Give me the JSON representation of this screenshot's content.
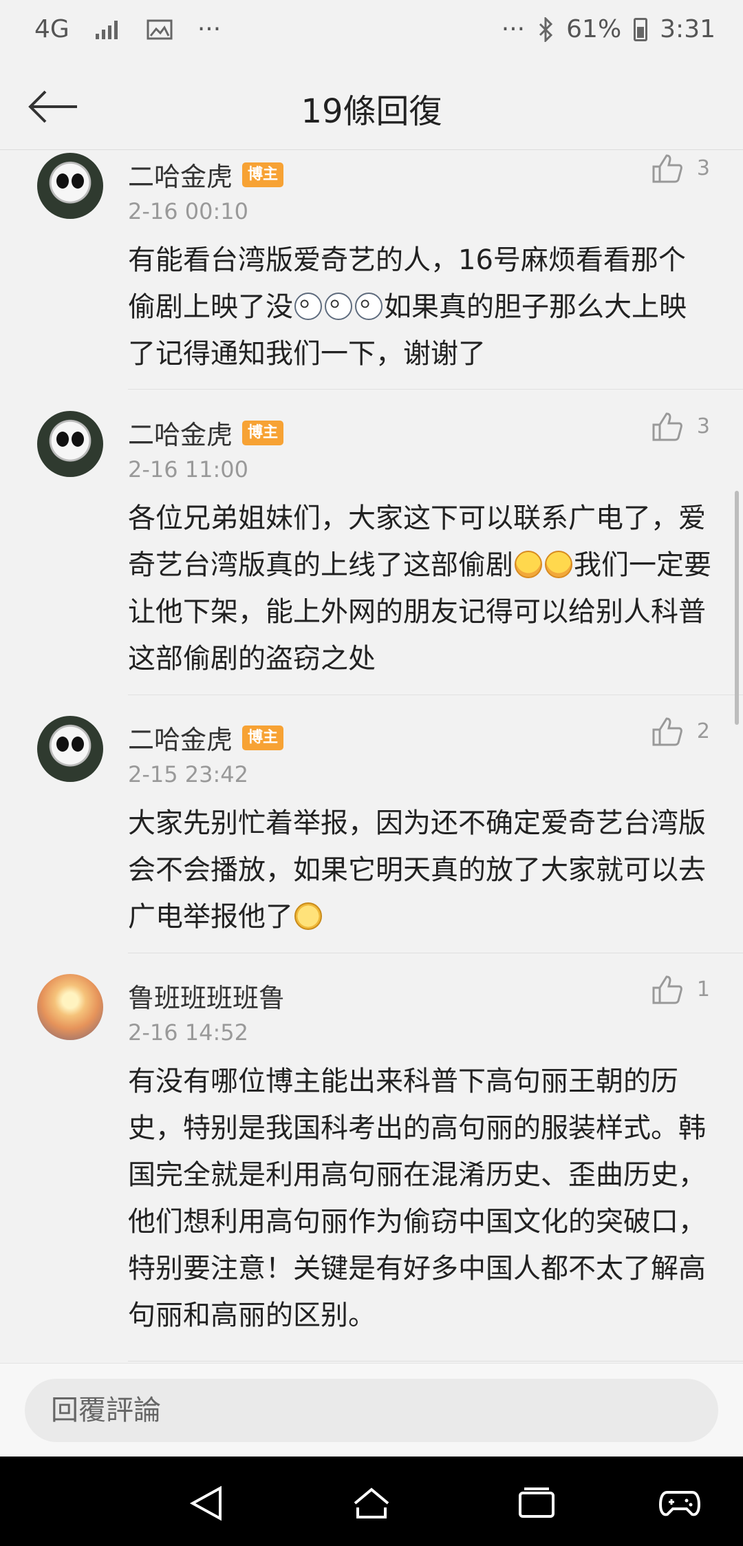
{
  "status_bar": {
    "network": "4G",
    "dots_left": "···",
    "dots_right": "···",
    "battery": "61%",
    "time": "3:31"
  },
  "header": {
    "title": "19條回復"
  },
  "comments": [
    {
      "user": "二哈金虎",
      "badge": "博主",
      "time": "2-16 00:10",
      "likes": "3",
      "text_a": "有能看台湾版爱奇艺的人，16号麻烦看看那个偷剧上映了没",
      "text_b": "如果真的胆子那么大上映了记得通知我们一下，谢谢了"
    },
    {
      "user": "二哈金虎",
      "badge": "博主",
      "time": "2-16 11:00",
      "likes": "3",
      "text_a": "各位兄弟姐妹们，大家这下可以联系广电了，爱奇艺台湾版真的上线了这部偷剧",
      "text_b": "我们一定要让他下架，能上外网的朋友记得可以给别人科普这部偷剧的盗窃之处"
    },
    {
      "user": "二哈金虎",
      "badge": "博主",
      "time": "2-15 23:42",
      "likes": "2",
      "text_a": "大家先别忙着举报，因为还不确定爱奇艺台湾版会不会播放，如果它明天真的放了大家就可以去广电举报他了"
    },
    {
      "user": "鲁班班班班鲁",
      "time": "2-16 14:52",
      "likes": "1",
      "text_a": "有没有哪位博主能出来科普下高句丽王朝的历史，特别是我国科考出的高句丽的服装样式。韩国完全就是利用高句丽在混淆历史、歪曲历史，他们想利用高句丽作为偷窃中国文化的突破口，特别要注意！关键是有好多中国人都不太了解高句丽和高丽的区别。"
    }
  ],
  "reply": {
    "placeholder": "回覆評論"
  },
  "icons": {
    "back": "back-arrow-icon",
    "like": "thumbs-up-icon",
    "nav_back": "triangle-back-icon",
    "nav_home": "home-icon",
    "nav_recents": "recents-icon",
    "nav_game": "gamepad-icon"
  },
  "colors": {
    "badge": "#f7a234",
    "background": "#f2f2f2",
    "muted_text": "#999999"
  }
}
